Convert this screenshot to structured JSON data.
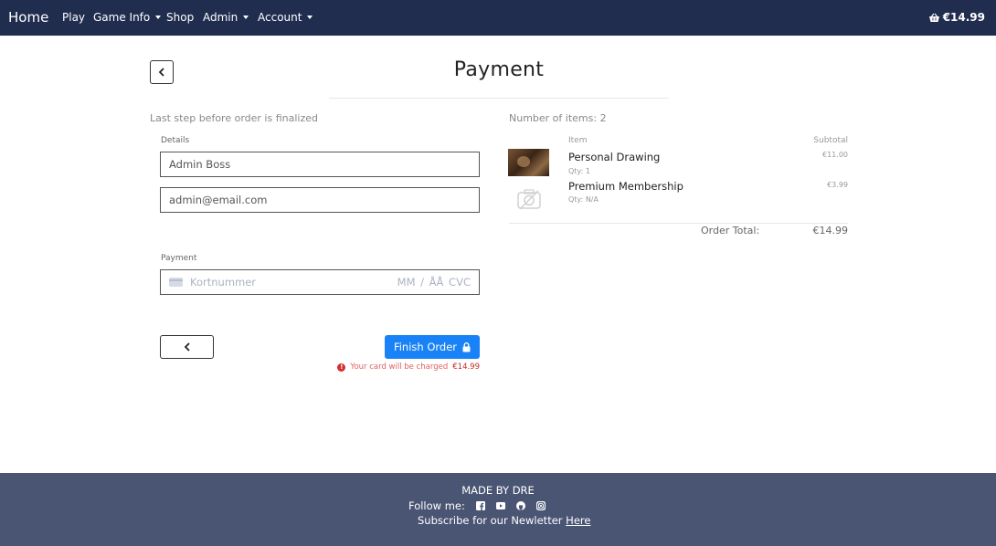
{
  "nav": {
    "brand": "Home",
    "items": [
      {
        "label": "Play",
        "dropdown": false
      },
      {
        "label": "Game Info",
        "dropdown": true
      },
      {
        "label": "Shop",
        "dropdown": false
      },
      {
        "label": "Admin",
        "dropdown": true
      },
      {
        "label": "Account",
        "dropdown": true
      }
    ],
    "cart_total": "€14.99",
    "cart_icon": "basket-icon"
  },
  "header": {
    "title": "Payment",
    "back_icon": "chevron-left-icon"
  },
  "checkout": {
    "subtitle": "Last step before order is finalized",
    "details_label": "Details",
    "name_value": "Admin Boss",
    "email_value": "admin@email.com",
    "payment_label": "Payment",
    "card_placeholder": "Kortnummer",
    "card_expiry_cvc_placeholder": "MM / ÅÅ  CVC",
    "finish_button_label": "Finish Order",
    "finish_button_icon": "lock-icon",
    "charge_note_text": "Your card will be charged",
    "charge_note_amount": "€14.99"
  },
  "summary": {
    "items_count_text": "Number of items: 2",
    "col_item": "Item",
    "col_subtotal": "Subtotal",
    "items": [
      {
        "name": "Personal Drawing",
        "qty": "Qty: 1",
        "subtotal": "€11.00"
      },
      {
        "name": "Premium Membership",
        "qty": "Qty: N/A",
        "subtotal": "€3.99"
      }
    ],
    "order_total_label": "Order Total:",
    "order_total_value": "€14.99"
  },
  "footer": {
    "made_by": "MADE BY DRE",
    "follow_label": "Follow me:",
    "social_icons": [
      "facebook-icon",
      "youtube-icon",
      "github-icon",
      "instagram-icon"
    ],
    "subscribe_text": "Subscribe for our Newletter",
    "subscribe_link": "Here"
  },
  "colors": {
    "navbar": "#212d4f",
    "footer": "#4a5574",
    "primary_button": "#1a82f7",
    "warning_text": "#d32f2f"
  }
}
